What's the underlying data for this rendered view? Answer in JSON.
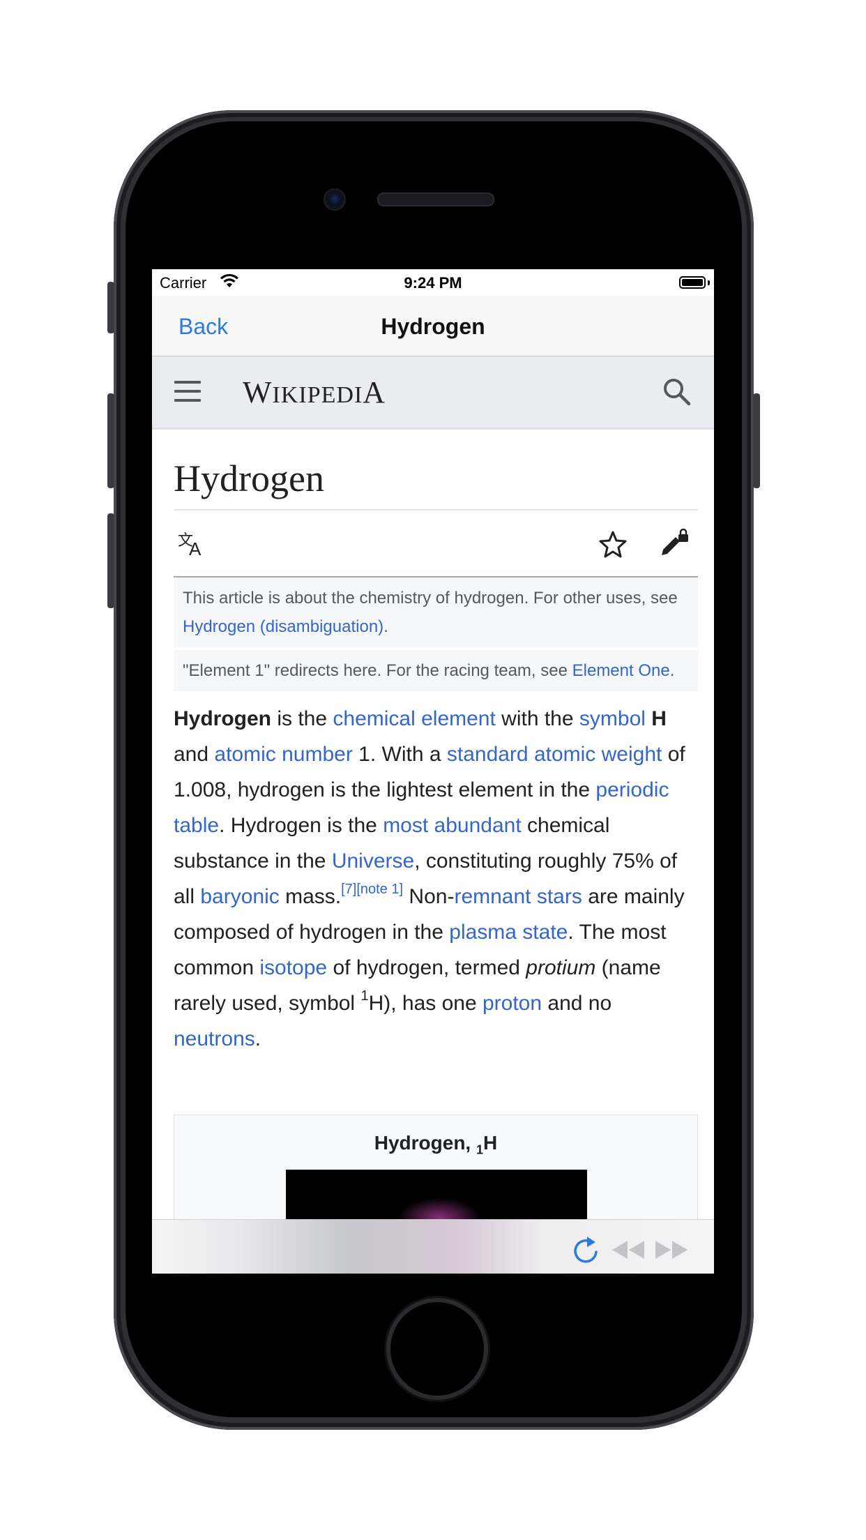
{
  "status_bar": {
    "carrier": "Carrier",
    "time": "9:24 PM"
  },
  "navbar": {
    "back_label": "Back",
    "title": "Hydrogen"
  },
  "wiki_header": {
    "wordmark_w": "W",
    "wordmark_ikipedi": "IKIPEDI",
    "wordmark_a": "A"
  },
  "article": {
    "heading": "Hydrogen",
    "hatnote1": {
      "text": "This article is about the chemistry of hydrogen. For other uses, see ",
      "link": "Hydrogen (disambiguation)",
      "end": "."
    },
    "hatnote2": {
      "text": "\"Element 1\" redirects here. For the racing team, see ",
      "link": "Element One",
      "end": "."
    },
    "para": {
      "b1": "Hydrogen",
      "t1": " is the ",
      "l1": "chemical element",
      "t2": " with the ",
      "l2": "symbol",
      "b2": "H",
      "t3": " and ",
      "l3": "atomic number",
      "t4": " 1. With a ",
      "l4": "standard atomic weight",
      "t5": " of 1.008, hydrogen is the lightest element in the ",
      "l5": "periodic table",
      "t6": ". Hydrogen is the ",
      "l6": "most abundant",
      "t7": " chemical substance in the ",
      "l7": "Universe",
      "t8": ", constituting roughly 75% of all ",
      "l8": "baryonic",
      "t9": " mass.",
      "s1": "[7]",
      "s2": "[note 1]",
      "t10": " Non-",
      "l9": "remnant stars",
      "t11": " are mainly composed of hydrogen in the ",
      "l10": "plasma state",
      "t12": ". The most common ",
      "l11": "isotope",
      "t13": " of hydrogen, termed ",
      "i1": "protium",
      "t14": " (name rarely used, symbol ",
      "sup1": "1",
      "t15": "H), has one ",
      "l12": "proton",
      "t16": " and no ",
      "l13": "neutrons",
      "t17": "."
    },
    "infobox": {
      "title": "Hydrogen, ",
      "sub": "1",
      "symbol": "H"
    }
  },
  "icons": {
    "menu": "hamburger-menu-icon",
    "search": "search-icon",
    "language": "language-icon",
    "watch": "star-icon",
    "edit": "edit-lock-icon",
    "reload": "reload-icon",
    "back": "rewind-icon",
    "forward": "fast-forward-icon"
  },
  "colors": {
    "link": "#3366cc",
    "ios_tint": "#2b7bde",
    "wiki_header_bg": "#eaecf0"
  }
}
